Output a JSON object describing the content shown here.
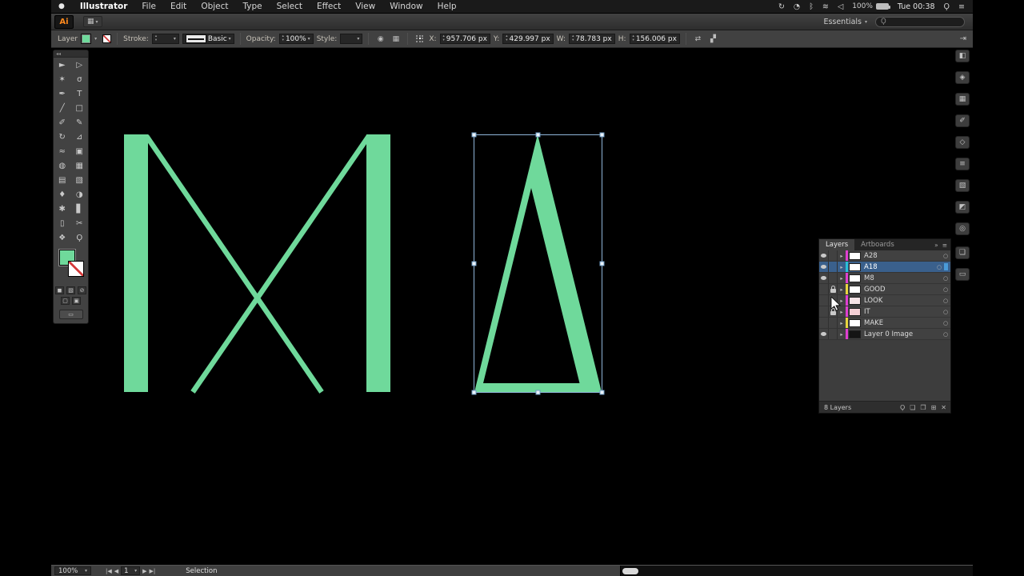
{
  "canvas": {
    "green": "#6FD99B",
    "selection_blue": "#8fb6d9"
  },
  "menu_bar": {
    "apple_glyph": "●",
    "items": [
      {
        "name": "menu-illustrator",
        "label": "Illustrator",
        "cls": "menu-item strong"
      },
      {
        "name": "menu-file",
        "label": "File",
        "cls": "menu-item"
      },
      {
        "name": "menu-edit",
        "label": "Edit",
        "cls": "menu-item"
      },
      {
        "name": "menu-object",
        "label": "Object",
        "cls": "menu-item"
      },
      {
        "name": "menu-type",
        "label": "Type",
        "cls": "menu-item"
      },
      {
        "name": "menu-select",
        "label": "Select",
        "cls": "menu-item"
      },
      {
        "name": "menu-effect",
        "label": "Effect",
        "cls": "menu-item"
      },
      {
        "name": "menu-view",
        "label": "View",
        "cls": "menu-item"
      },
      {
        "name": "menu-window",
        "label": "Window",
        "cls": "menu-item"
      },
      {
        "name": "menu-help",
        "label": "Help",
        "cls": "menu-item"
      }
    ],
    "status_icons": [
      {
        "name": "sync-icon",
        "glyph": "↻"
      },
      {
        "name": "time-machine-icon",
        "glyph": "◔"
      },
      {
        "name": "bluetooth-icon",
        "glyph": "ᛒ"
      },
      {
        "name": "wifi-icon",
        "glyph": "≋"
      },
      {
        "name": "volume-icon",
        "glyph": "◁"
      }
    ],
    "battery_label": "100%",
    "clock": "Tue 00:38",
    "spotlight_glyph": "Ϙ",
    "notification_glyph": "≡"
  },
  "app_bar": {
    "logo": "Ai",
    "arrange_glyph": "▦",
    "workspace_label": "Essentials",
    "search_glyph": "Ϙ"
  },
  "control_bar": {
    "context_label": "Layer",
    "stroke_label": "Stroke:",
    "stroke_value": "",
    "brush_label": "Basic",
    "opacity_label": "Opacity:",
    "opacity_value": "100%",
    "style_label": "Style:",
    "recolor_glyph": "◉",
    "doc_setup_glyph": "▦",
    "x_label": "X:",
    "x_value": "957.706 px",
    "y_label": "Y:",
    "y_value": "429.997 px",
    "w_label": "W:",
    "w_value": "78.783 px",
    "h_label": "H:",
    "h_value": "156.006 px",
    "transform_glyph": "⇄",
    "align_glyph": "▞",
    "collapse_glyph": "⇥"
  },
  "toolbar": {
    "header_glyph": "◂◂",
    "tools": [
      {
        "name": "selection-tool",
        "glyph": "►"
      },
      {
        "name": "direct-selection-tool",
        "glyph": "▷"
      },
      {
        "name": "magic-wand-tool",
        "glyph": "✶"
      },
      {
        "name": "lasso-tool",
        "glyph": "σ"
      },
      {
        "name": "pen-tool",
        "glyph": "✒"
      },
      {
        "name": "type-tool",
        "glyph": "T"
      },
      {
        "name": "line-segment-tool",
        "glyph": "╱"
      },
      {
        "name": "rectangle-tool",
        "glyph": "□"
      },
      {
        "name": "paintbrush-tool",
        "glyph": "✐"
      },
      {
        "name": "pencil-tool",
        "glyph": "✎"
      },
      {
        "name": "rotate-tool",
        "glyph": "↻"
      },
      {
        "name": "scale-tool",
        "glyph": "⊿"
      },
      {
        "name": "width-tool",
        "glyph": "≈"
      },
      {
        "name": "free-transform-tool",
        "glyph": "▣"
      },
      {
        "name": "shape-builder-tool",
        "glyph": "◍"
      },
      {
        "name": "perspective-grid-tool",
        "glyph": "▦"
      },
      {
        "name": "mesh-tool",
        "glyph": "▤"
      },
      {
        "name": "gradient-tool",
        "glyph": "▧"
      },
      {
        "name": "eyedropper-tool",
        "glyph": "♦"
      },
      {
        "name": "blend-tool",
        "glyph": "◑"
      },
      {
        "name": "symbol-sprayer-tool",
        "glyph": "✱"
      },
      {
        "name": "column-graph-tool",
        "glyph": "▋"
      },
      {
        "name": "artboard-tool",
        "glyph": "▯"
      },
      {
        "name": "slice-tool",
        "glyph": "✂"
      },
      {
        "name": "hand-tool",
        "glyph": "❖"
      },
      {
        "name": "zoom-tool",
        "glyph": "Ϙ"
      }
    ],
    "color_btn_glyph": "◼",
    "gradient_btn_glyph": "▧",
    "none_btn_glyph": "⊘",
    "draw_normal_glyph": "▢",
    "draw_behind_glyph": "▣",
    "draw_inside_glyph": "回",
    "screen_mode_glyph": "▭"
  },
  "dock": {
    "panels": [
      {
        "name": "color-panel-icon",
        "glyph": "◧"
      },
      {
        "name": "color-guide-panel-icon",
        "glyph": "◈"
      },
      {
        "name": "swatches-panel-icon",
        "glyph": "▦"
      },
      {
        "name": "brushes-panel-icon",
        "glyph": "✐"
      },
      {
        "name": "symbols-panel-icon",
        "glyph": "◇"
      },
      {
        "name": "stroke-panel-icon",
        "glyph": "≡"
      },
      {
        "name": "gradient-panel-icon",
        "glyph": "▧"
      },
      {
        "name": "transparency-panel-icon",
        "glyph": "◩"
      },
      {
        "name": "appearance-panel-icon",
        "glyph": "◎"
      }
    ],
    "panels2": [
      {
        "name": "layers-panel-icon",
        "glyph": "❏"
      },
      {
        "name": "artboards-panel-icon",
        "glyph": "▭"
      }
    ]
  },
  "layers_panel": {
    "tab_layers": "Layers",
    "tab_artboards": "Artboards",
    "collapse_glyph": "»",
    "menu_glyph": "≡",
    "rows": [
      {
        "dn": "layer-row-a28",
        "label": "A28",
        "row_class": "layer-row",
        "eye_style": "",
        "lock_style": "visibility:hidden",
        "bar_style": "background:#df3fd0",
        "thumb_style": "background:#ffffff",
        "chip_style": "display:none",
        "target": "○"
      },
      {
        "dn": "layer-row-a18",
        "label": "A18",
        "row_class": "layer-row selected",
        "eye_style": "",
        "lock_style": "visibility:hidden",
        "bar_style": "background:#29c0d8",
        "thumb_style": "background:#ffffff",
        "chip_style": "background:#4a9bd8",
        "target": "○"
      },
      {
        "dn": "layer-row-m8",
        "label": "M8",
        "row_class": "layer-row",
        "eye_style": "",
        "lock_style": "visibility:hidden",
        "bar_style": "background:#df3fd0",
        "thumb_style": "background:#ffffff",
        "chip_style": "display:none",
        "target": "○"
      },
      {
        "dn": "layer-row-good",
        "label": "GOOD",
        "row_class": "layer-row",
        "eye_style": "visibility:hidden",
        "lock_style": "",
        "bar_style": "background:#e8d53f",
        "thumb_style": "background:#ffffff",
        "chip_style": "display:none",
        "target": "○"
      },
      {
        "dn": "layer-row-look",
        "label": "LOOK",
        "row_class": "layer-row",
        "eye_style": "visibility:hidden",
        "lock_style": "visibility:hidden",
        "bar_style": "background:#df3fd0",
        "thumb_style": "background:#f6e3e6",
        "chip_style": "display:none",
        "target": "○"
      },
      {
        "dn": "layer-row-it",
        "label": "IT",
        "row_class": "layer-row",
        "eye_style": "visibility:hidden",
        "lock_style": "",
        "bar_style": "background:#df3fd0",
        "thumb_style": "background:#f3cfd5",
        "chip_style": "display:none",
        "target": "○"
      },
      {
        "dn": "layer-row-make",
        "label": "MAKE",
        "row_class": "layer-row",
        "eye_style": "visibility:hidden",
        "lock_style": "visibility:hidden",
        "bar_style": "background:#e8d53f",
        "thumb_style": "background:#ffffff",
        "chip_style": "display:none",
        "target": "○"
      },
      {
        "dn": "layer-row-layer0image",
        "label": "Layer 0 Image",
        "row_class": "layer-row",
        "eye_style": "",
        "lock_style": "visibility:hidden",
        "bar_style": "background:#df3fd0",
        "thumb_style": "background:#141414",
        "chip_style": "display:none",
        "target": "○"
      }
    ],
    "footer_label": "8 Layers",
    "footer_icons": [
      {
        "name": "locate-object-icon",
        "glyph": "Ϙ"
      },
      {
        "name": "make-clipping-mask-icon",
        "glyph": "❏"
      },
      {
        "name": "new-sublayer-icon",
        "glyph": "❐"
      },
      {
        "name": "new-layer-icon",
        "glyph": "⊞"
      },
      {
        "name": "delete-layer-icon",
        "glyph": "✕"
      }
    ]
  },
  "status_bar": {
    "zoom": "100%",
    "first_glyph": "|◀",
    "prev_glyph": "◀",
    "artboard": "1",
    "next_glyph": "▶",
    "last_glyph": "▶|",
    "status_label": "Selection"
  }
}
